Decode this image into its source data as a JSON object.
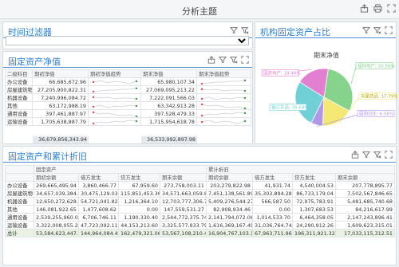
{
  "app": {
    "title": "分析主题"
  },
  "top_icons": [
    "export-icon",
    "print-icon",
    "fullscreen-icon"
  ],
  "filter_panel": {
    "title": "时间过滤器",
    "select_value": "",
    "icons": [
      "filter-icon",
      "clear-filter-icon"
    ]
  },
  "net_panel": {
    "title": "固定资产净值",
    "icons": [
      "export-icon",
      "filter-icon",
      "clear-filter-icon",
      "expand-icon"
    ],
    "headers": [
      "二级科目",
      "期初净值",
      "期初净值趋势",
      "期末净值",
      "期末净值趋势"
    ],
    "rows": [
      {
        "cat": "办公设备",
        "begin": "66,685,672.96",
        "end": "65,980,107.34"
      },
      {
        "cat": "房屋建筑物",
        "begin": "27,205,900,822.31",
        "end": "27,069,095,213.22"
      },
      {
        "cat": "机器设备",
        "begin": "7,240,996,084.72",
        "end": "7,222,091,566.03"
      },
      {
        "cat": "其他",
        "begin": "63,172,988.19",
        "end": "63,342,913.28"
      },
      {
        "cat": "通用设备",
        "begin": "397,461,887.97",
        "end": "397,528,479.33"
      },
      {
        "cat": "运输设备",
        "begin": "1,705,638,887.79",
        "end": "1,715,954,618.78"
      }
    ],
    "total_begin": "36,679,856,343.94",
    "total_end": "36,533,992,897.98"
  },
  "pie_panel": {
    "title": "机构固定资产占比",
    "icons": [
      "filter-icon",
      "clear-filter-icon",
      "expand-icon"
    ],
    "chart_title": "期末净值",
    "colors": {
      "green": "#86d48c",
      "yellow": "#f3e874",
      "blue": "#7fb2e8",
      "teal": "#6fd0d6",
      "pink": "#e27fd0",
      "purple": "#b296e8"
    }
  },
  "chart_data": {
    "type": "pie",
    "title": "期末净值",
    "labels": [
      "福祥地产",
      "天星药品",
      "国阳日化",
      "银江东品",
      "国资地产"
    ],
    "values": [
      30.56,
      17.79,
      6.56,
      26.69,
      18.4
    ],
    "value_labels": [
      "福祥地产: 30.56%",
      "天星药品: 17.79%",
      "国阳日化: 6.56%",
      "银江东品: 26.69%",
      "国资地产: 18.40%"
    ],
    "color_keys": [
      "green",
      "yellow",
      "purple",
      "teal",
      "pink"
    ]
  },
  "dep_panel": {
    "title": "固定资产和累计折旧",
    "icons": [
      "export-icon",
      "filter-icon",
      "clear-filter-icon",
      "expand-icon"
    ],
    "group1": "固定资产",
    "group2": "累计折旧",
    "headers": [
      "期初余额",
      "借方发生",
      "贷方发生",
      "期末余额",
      "期初余额",
      "借方发生",
      "贷方发生",
      "期末余额"
    ],
    "rows": [
      {
        "cat": "办公设备",
        "v": [
          "269,665,495.94",
          "3,860,466.77",
          "67,959.60",
          "273,758,003.11",
          "203,279,822.98",
          "41,931.74",
          "4,540,004.53",
          "207,778,895.77"
        ]
      },
      {
        "cat": "房屋建筑物",
        "v": [
          "34,657,039,384.20",
          "30,475,129.03",
          "115,851,453.36",
          "34,571,663,059.87",
          "7,451,138,561.89",
          "35,303,894.28",
          "86,733,179.04",
          "7,502,567,846.65"
        ]
      },
      {
        "cat": "机器设备",
        "v": [
          "12,650,272,628.99",
          "54,721,041.82",
          "1,216,364.10",
          "12,703,777,306.71",
          "5,409,276,544.27",
          "566,587.50",
          "72,975,783.91",
          "5,481,685,740.68"
        ]
      },
      {
        "cat": "其他",
        "v": [
          "146,081,922.65",
          "1,477,608.62",
          "0.00",
          "147,559,531.27",
          "82,908,934.46",
          "0.00",
          "1,307,683.53",
          "84,216,617.99"
        ]
      },
      {
        "cat": "通用设备",
        "v": [
          "2,539,255,960.03",
          "6,706,746.11",
          "1,190,330.40",
          "2,544,772,375.74",
          "2,141,794,072.06",
          "1,014,533.70",
          "6,464,358.05",
          "2,147,243,896.41"
        ]
      },
      {
        "cat": "运输设备",
        "v": [
          "3,322,008,055.28",
          "47,723,092.11",
          "44,153,213.60",
          "3,325,577,933.79",
          "1,616,369,167.49",
          "31,036,764.74",
          "24,290,912.26",
          "1,609,623,315.01"
        ]
      }
    ],
    "total": {
      "cat": "总计",
      "v": [
        "53,584,623,447.09",
        "144,964,084.46",
        "162,479,321.06",
        "53,567,108,210.49",
        "16,904,767,103.15",
        "67,963,711.96",
        "196,311,921.32",
        "17,033,115,312.51"
      ]
    }
  }
}
